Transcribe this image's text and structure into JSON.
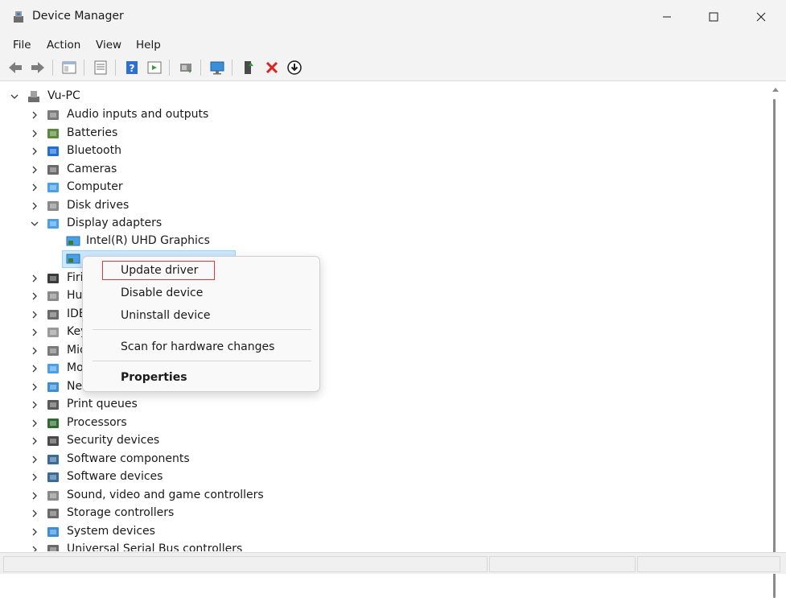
{
  "window": {
    "title": "Device Manager"
  },
  "menu": [
    "File",
    "Action",
    "View",
    "Help"
  ],
  "toolbar_icons": [
    "back-arrow-icon",
    "forward-arrow-icon",
    "show-hide-console-tree-icon",
    "properties-icon",
    "help-icon",
    "action-pane-icon",
    "update-driver-icon",
    "scan-hardware-icon",
    "add-legacy-hardware-icon",
    "remove-device-icon",
    "download-driver-icon"
  ],
  "tree": {
    "root": "Vu-PC",
    "categories": [
      {
        "label": "Audio inputs and outputs"
      },
      {
        "label": "Batteries"
      },
      {
        "label": "Bluetooth"
      },
      {
        "label": "Cameras"
      },
      {
        "label": "Computer"
      },
      {
        "label": "Disk drives"
      },
      {
        "label": "Display adapters"
      },
      {
        "label": "Firmware",
        "visible": "Firi"
      },
      {
        "label": "Human Interface Devices",
        "visible": "Hu"
      },
      {
        "label": "IDE ATA/ATAPI controllers",
        "visible": "IDE"
      },
      {
        "label": "Keyboards",
        "visible": "Key"
      },
      {
        "label": "Mice and other pointing devices",
        "visible": "Mic"
      },
      {
        "label": "Monitors",
        "visible": "Mo"
      },
      {
        "label": "Network adapters",
        "visible": "Ne"
      },
      {
        "label": "Print queues"
      },
      {
        "label": "Processors"
      },
      {
        "label": "Security devices"
      },
      {
        "label": "Software components"
      },
      {
        "label": "Software devices"
      },
      {
        "label": "Sound, video and game controllers"
      },
      {
        "label": "Storage controllers"
      },
      {
        "label": "System devices"
      },
      {
        "label": "Universal Serial Bus controllers"
      }
    ],
    "display_children": [
      "Intel(R) UHD Graphics",
      ""
    ]
  },
  "context_menu": {
    "items": [
      "Update driver",
      "Disable device",
      "Uninstall device",
      "Scan for hardware changes",
      "Properties"
    ]
  },
  "colors": {
    "selection": "#cce8ff",
    "highlight_border": "#d8393a",
    "chrome": "#f3f3f3"
  }
}
